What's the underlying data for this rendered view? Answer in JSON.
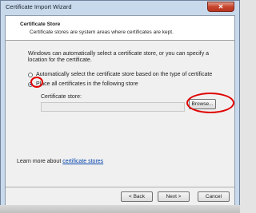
{
  "window": {
    "title": "Certificate Import Wizard",
    "close_glyph": "✕"
  },
  "header": {
    "title": "Certificate Store",
    "subtitle": "Certificate stores are system areas where certificates are kept."
  },
  "body": {
    "intro": "Windows can automatically select a certificate store, or you can specify a location for the certificate.",
    "options": [
      {
        "label": "Automatically select the certificate store based on the type of certificate",
        "selected": false
      },
      {
        "label": "Place all certificates in the following store",
        "selected": true
      }
    ],
    "store_label": "Certificate store:",
    "store_value": "",
    "browse_label": "Browse..."
  },
  "learn_more": {
    "prefix": "Learn more about ",
    "link": "certificate stores"
  },
  "footer": {
    "back_label": "< Back",
    "next_label": "Next >",
    "cancel_label": "Cancel"
  },
  "colors": {
    "annotation": "#e00000",
    "link": "#0645ad",
    "radio_dot": "#1a5fb4"
  }
}
